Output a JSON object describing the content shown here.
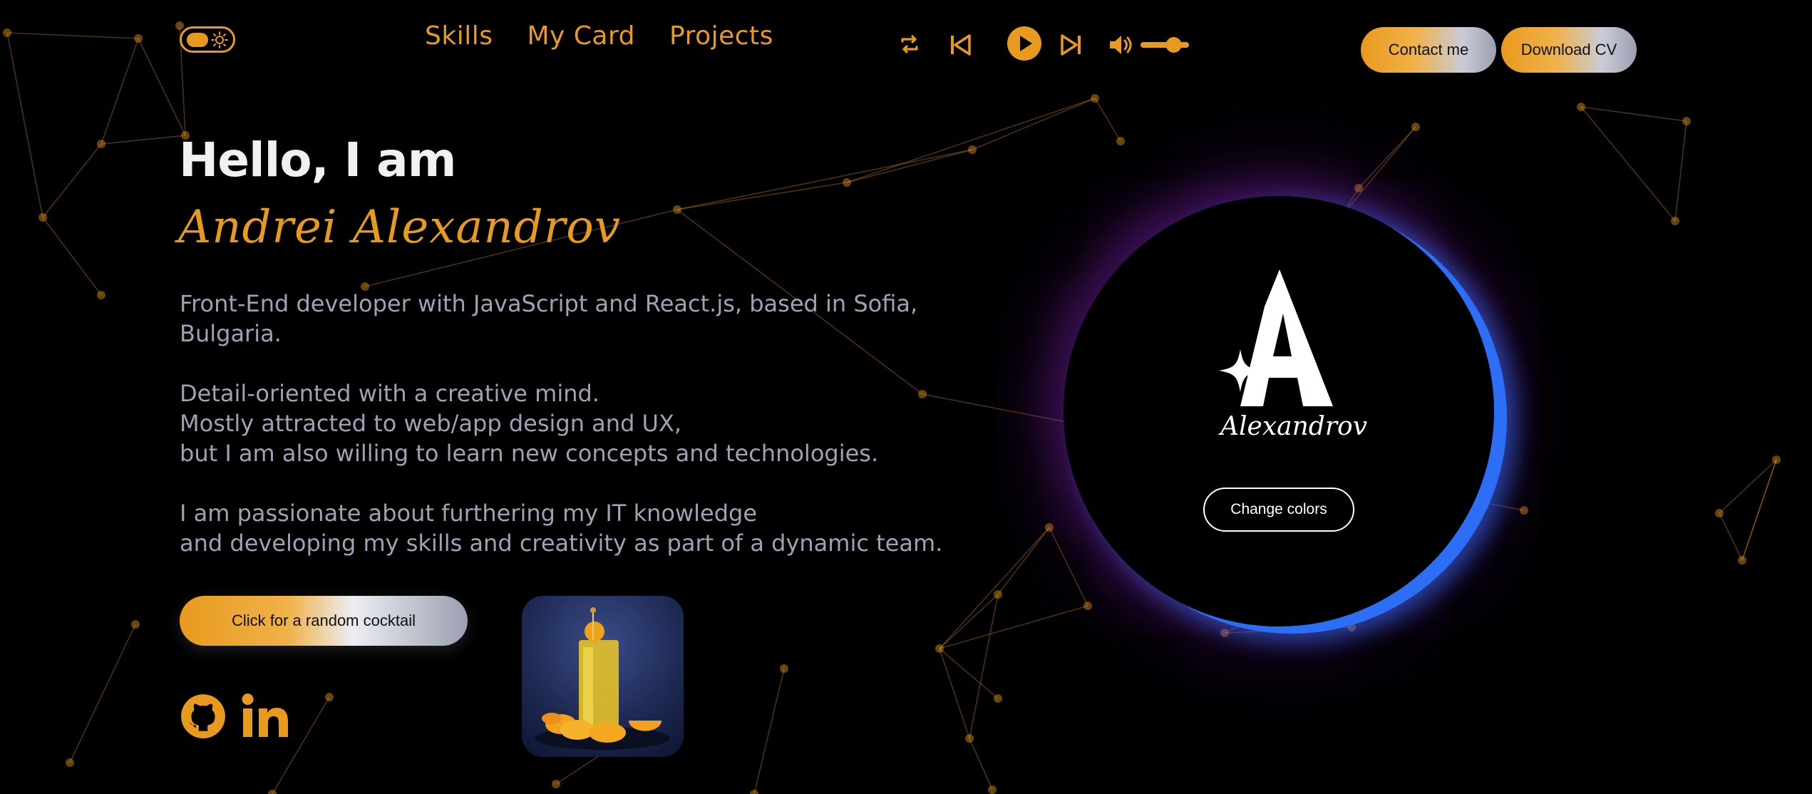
{
  "nav": {
    "links": [
      "Skills",
      "My Card",
      "Projects"
    ]
  },
  "header": {
    "contact_label": "Contact me",
    "download_label": "Download CV"
  },
  "player": {
    "icons": [
      "repeat-icon",
      "previous-icon",
      "play-icon",
      "next-icon",
      "volume-icon"
    ],
    "volume_level": 0.7
  },
  "hero": {
    "greeting": "Hello, I am",
    "name": "Andrei Alexandrov",
    "bio": [
      [
        "Front-End developer with JavaScript and React.js, based in Sofia,",
        "Bulgaria."
      ],
      [
        "Detail-oriented with a creative mind.",
        "Mostly attracted to web/app design and UX,",
        "but I am also willing to learn new concepts and technologies."
      ],
      [
        "I am passionate about furthering my IT knowledge",
        "and developing my skills and creativity as part of a dynamic team."
      ]
    ],
    "cocktail_label": "Click for a random cocktail"
  },
  "card": {
    "logo_letter": "A",
    "logo_signature": "Alexandrov",
    "change_colors_label": "Change colors"
  },
  "social": [
    "github-icon",
    "linkedin-icon"
  ],
  "colors": {
    "accent": "#e89a1e",
    "background": "#000000",
    "text": "#9ea2b4",
    "orb_glow": "#2d6ef7",
    "orb_purple": "#9628c8"
  }
}
